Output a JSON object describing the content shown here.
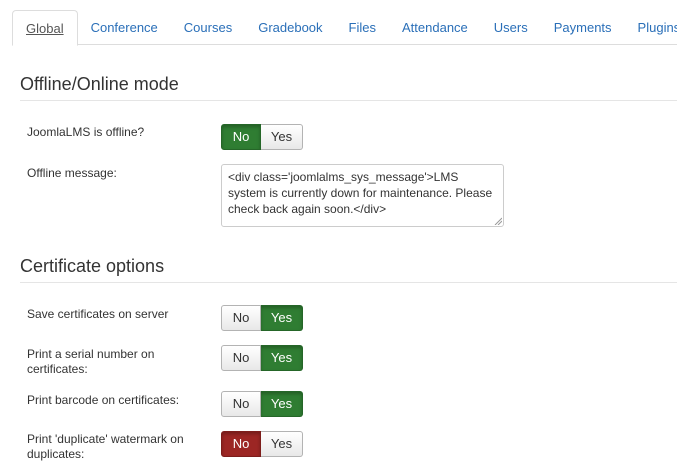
{
  "tabs": [
    "Global",
    "Conference",
    "Courses",
    "Gradebook",
    "Files",
    "Attendance",
    "Users",
    "Payments",
    "Plugins"
  ],
  "active_tab": "Global",
  "sections": {
    "offline": {
      "title": "Offline/Online mode",
      "offline_label": "JoomlaLMS is offline?",
      "offline_no": "No",
      "offline_yes": "Yes",
      "offline_selected": "No",
      "message_label": "Offline message:",
      "message_value": "<div class='joomlalms_sys_message'>LMS system is currently down for maintenance. Please check back again soon.</div>"
    },
    "certificate": {
      "title": "Certificate options",
      "save_label": "Save certificates on server",
      "serial_label": "Print a serial number on certificates:",
      "barcode_label": "Print barcode on certificates:",
      "duplicate_label": "Print 'duplicate' watermark on duplicates:",
      "no": "No",
      "yes": "Yes",
      "save_selected": "Yes",
      "serial_selected": "Yes",
      "barcode_selected": "Yes",
      "duplicate_selected": "No"
    }
  },
  "colors": {
    "selected_yes": "#2f7d32",
    "selected_no_danger": "#9c2624",
    "link": "#2a6fb8"
  }
}
